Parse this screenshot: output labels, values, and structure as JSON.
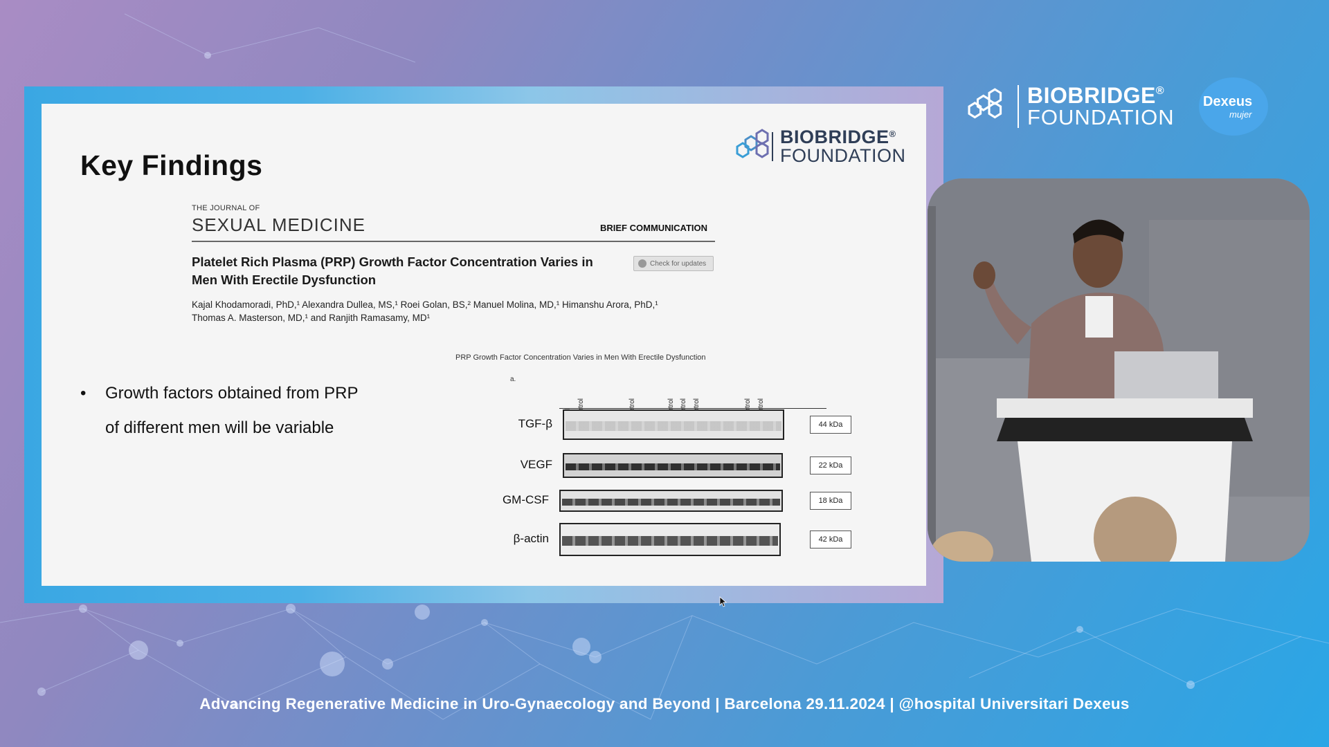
{
  "slide": {
    "title": "Key Findings",
    "logo": {
      "line1": "BIOBRIDGE",
      "reg": "®",
      "line2": "FOUNDATION"
    },
    "journal": {
      "small": "THE JOURNAL OF",
      "name": "SEXUAL MEDICINE",
      "section": "BRIEF COMMUNICATION",
      "paper_title": "Platelet Rich Plasma (PRP) Growth Factor Concentration Varies in Men With Erectile Dysfunction",
      "check_updates": "Check for updates",
      "authors_line1": "Kajal Khodamoradi, PhD,¹ Alexandra Dullea, MS,¹ Roei Golan, BS,² Manuel Molina, MD,¹ Himanshu Arora, PhD,¹",
      "authors_line2": "Thomas A. Masterson, MD,¹ and Ranjith Ramasamy, MD¹"
    },
    "bullet": "Growth factors obtained from PRP of different men will be variable",
    "bullet_marker": "•",
    "figure": {
      "caption": "PRP Growth Factor Concentration Varies in Men With Erectile Dysfunction",
      "panel": "a.",
      "lanes": [
        "Control",
        "PD control",
        "ED",
        "ED",
        "ED",
        "PD control",
        "ED",
        "ED",
        "PD control",
        "PD control",
        "PD control",
        "ED",
        "ED",
        "ED",
        "PD control",
        "PD control"
      ],
      "bands": [
        {
          "label": "TGF-β",
          "kda": "44 kDa"
        },
        {
          "label": "VEGF",
          "kda": "22 kDa"
        },
        {
          "label": "GM-CSF",
          "kda": "18 kDa"
        },
        {
          "label": "β-actin",
          "kda": "42 kDa"
        }
      ]
    }
  },
  "header": {
    "logo": {
      "line1": "BIOBRIDGE",
      "reg": "®",
      "line2": "FOUNDATION"
    },
    "partner": {
      "name": "Dexeus",
      "sub": "mujer"
    }
  },
  "footer": "Advancing Regenerative Medicine in Uro-Gynaecology and Beyond | Barcelona 29.11.2024 | @hospital Universitari Dexeus",
  "colors": {
    "accent": "#2aa6e6",
    "logo_dark": "#2f3e57"
  }
}
